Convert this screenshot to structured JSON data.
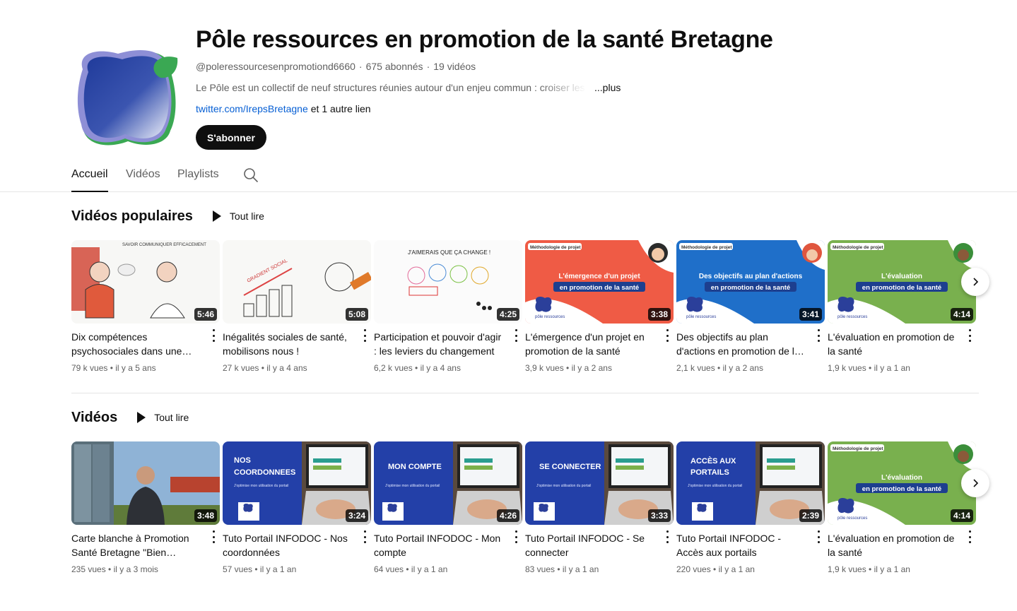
{
  "channel": {
    "title": "Pôle ressources en promotion de la santé Bretagne",
    "handle": "@poleressourcesenpromotiond6660",
    "subscribers": "675 abonnés",
    "video_count": "19 vidéos",
    "meta_sep": "·",
    "description": "Le Pôle est un collectif de neuf structures réunies autour d'un enjeu commun : croiser les",
    "more_label": "...plus",
    "link_text": "twitter.com/IrepsBretagne",
    "other_links": "et 1 autre lien",
    "subscribe_label": "S'abonner",
    "colors": {
      "logo_blue": "#2b3f9a",
      "logo_green": "#3aa853",
      "logo_purple": "#8e8fd6"
    }
  },
  "tabs": [
    {
      "label": "Accueil",
      "active": true
    },
    {
      "label": "Vidéos",
      "active": false
    },
    {
      "label": "Playlists",
      "active": false
    }
  ],
  "search_icon": "search-icon",
  "sections": [
    {
      "title": "Vidéos populaires",
      "play_all": "Tout lire",
      "videos": [
        {
          "title": "Dix compétences psychosociales dans une…",
          "duration": "5:46",
          "views": "79 k vues",
          "age": "il y a 5 ans",
          "thumb_text": "SAVOIR COMMUNIQUER EFFICACEMENT"
        },
        {
          "title": "Inégalités sociales de santé, mobilisons nous !",
          "duration": "5:08",
          "views": "27 k vues",
          "age": "il y a 4 ans",
          "thumb_text": "GRADIENT SOCIAL"
        },
        {
          "title": "Participation et pouvoir d'agir : les leviers du changement",
          "duration": "4:25",
          "views": "6,2 k vues",
          "age": "il y a 4 ans",
          "thumb_text": "J'AIMERAIS QUE ÇA CHANGE !"
        },
        {
          "title": "L'émergence d'un projet en promotion de la santé",
          "duration": "3:38",
          "views": "3,9 k vues",
          "age": "il y a 2 ans",
          "thumb_tag": "Méthodologie de projet",
          "thumb_line1": "L'émergence d'un projet",
          "thumb_line2": "en promotion de la santé"
        },
        {
          "title": "Des objectifs au plan d'actions en promotion de l…",
          "duration": "3:41",
          "views": "2,1 k vues",
          "age": "il y a 2 ans",
          "thumb_tag": "Méthodologie de projet",
          "thumb_line1": "Des objectifs au plan d'actions",
          "thumb_line2": "en promotion de la santé"
        },
        {
          "title": "L'évaluation en promotion de la santé",
          "duration": "4:14",
          "views": "1,9 k vues",
          "age": "il y a 1 an",
          "thumb_tag": "Méthodologie de projet",
          "thumb_line1": "L'évaluation",
          "thumb_line2": "en promotion de la santé"
        }
      ]
    },
    {
      "title": "Vidéos",
      "play_all": "Tout lire",
      "videos": [
        {
          "title": "Carte blanche à Promotion Santé Bretagne \"Bien vieillir…",
          "duration": "3:48",
          "views": "235 vues",
          "age": "il y a 3 mois"
        },
        {
          "title": "Tuto Portail INFODOC - Nos coordonnées",
          "duration": "3:24",
          "views": "57 vues",
          "age": "il y a 1 an",
          "thumb_line1": "NOS",
          "thumb_line2": "COORDONNEES",
          "thumb_sub": "J'optimise mon utilisation du portail"
        },
        {
          "title": "Tuto Portail INFODOC - Mon compte",
          "duration": "4:26",
          "views": "64 vues",
          "age": "il y a 1 an",
          "thumb_line1": "MON COMPTE",
          "thumb_line2": "",
          "thumb_sub": "J'optimise mon utilisation du portail"
        },
        {
          "title": "Tuto Portail INFODOC - Se connecter",
          "duration": "3:33",
          "views": "83 vues",
          "age": "il y a 1 an",
          "thumb_line1": "SE CONNECTER",
          "thumb_line2": "",
          "thumb_sub": "J'optimise mon utilisation du portail"
        },
        {
          "title": "Tuto Portail INFODOC - Accès aux portails",
          "duration": "2:39",
          "views": "220 vues",
          "age": "il y a 1 an",
          "thumb_line1": "ACCÈS AUX",
          "thumb_line2": "PORTAILS",
          "thumb_sub": "J'optimise mon utilisation du portail"
        },
        {
          "title": "L'évaluation en promotion de la santé",
          "duration": "4:14",
          "views": "1,9 k vues",
          "age": "il y a 1 an",
          "thumb_tag": "Méthodologie de projet",
          "thumb_line1": "L'évaluation",
          "thumb_line2": "en promotion de la santé"
        }
      ]
    }
  ],
  "brand_small": "pôle ressources",
  "meta_dot": " • ",
  "next_icon": "chevron-right-icon",
  "kebab_icon": "more-vert-icon"
}
